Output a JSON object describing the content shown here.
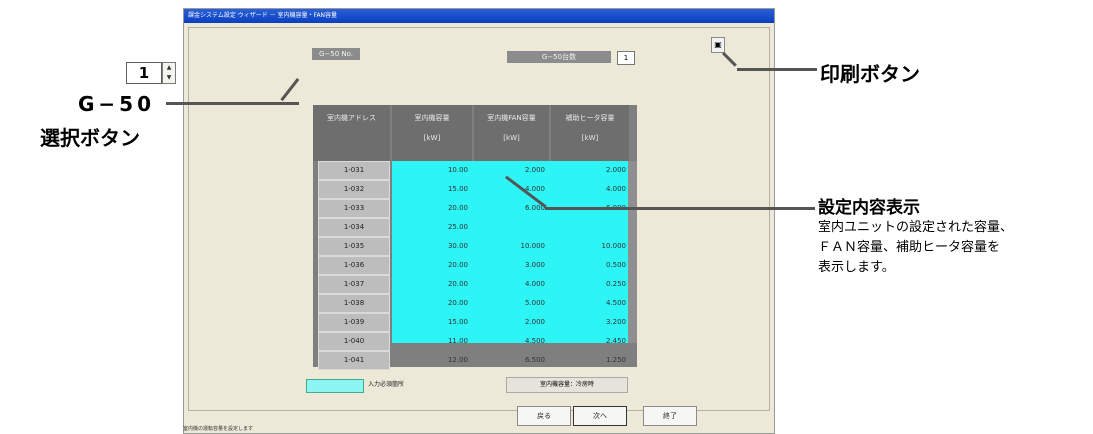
{
  "window": {
    "title": "課金システム設定 ウィザード － 室内機容量・FAN容量"
  },
  "g50_no": {
    "label": "G−50 No.",
    "value": "1",
    "up": "▲",
    "down": "▼"
  },
  "g50_count": {
    "label": "G−50台数",
    "value": "1"
  },
  "print_icon": "▣",
  "table": {
    "headers": [
      {
        "line1": "室内機アドレス",
        "line2": ""
      },
      {
        "line1": "室内機容量",
        "line2": "[kW]"
      },
      {
        "line1": "室内機FAN容量",
        "line2": "[kW]"
      },
      {
        "line1": "補助ヒータ容量",
        "line2": "[kW]"
      }
    ],
    "rows": [
      [
        "1-031",
        "10.00",
        "2.000",
        "2.000"
      ],
      [
        "1-032",
        "15.00",
        "4.000",
        "4.000"
      ],
      [
        "1-033",
        "20.00",
        "6.000",
        "6.000"
      ],
      [
        "1-034",
        "25.00",
        "",
        ""
      ],
      [
        "1-035",
        "30.00",
        "10.000",
        "10.000"
      ],
      [
        "1-036",
        "20.00",
        "3.000",
        "0.500"
      ],
      [
        "1-037",
        "20.00",
        "4.000",
        "0.250"
      ],
      [
        "1-038",
        "20.00",
        "5.000",
        "4.500"
      ],
      [
        "1-039",
        "15.00",
        "2.000",
        "3.200"
      ],
      [
        "1-040",
        "11.00",
        "4.500",
        "2.450"
      ],
      [
        "1-041",
        "12.00",
        "6.500",
        "1.250"
      ]
    ]
  },
  "legend": {
    "text": "入力必須箇所",
    "mode": "室内機容量：冷房時"
  },
  "buttons": {
    "back": "戻る",
    "next": "次へ",
    "exit": "終了"
  },
  "status_text": "室内機の運転容量を設定します",
  "callouts": {
    "g50_select_line1": "G−50",
    "g50_select_line2": "選択ボタン",
    "print_button": "印刷ボタン",
    "settings_title": "設定内容表示",
    "settings_desc1": "室内ユニットの設定された容量、",
    "settings_desc2": "ＦＡＮ容量、補助ヒータ容量を",
    "settings_desc3": "表示します。"
  },
  "colors": {
    "input_required": "#2df5f5",
    "title_bar": "#0a3fc0"
  }
}
